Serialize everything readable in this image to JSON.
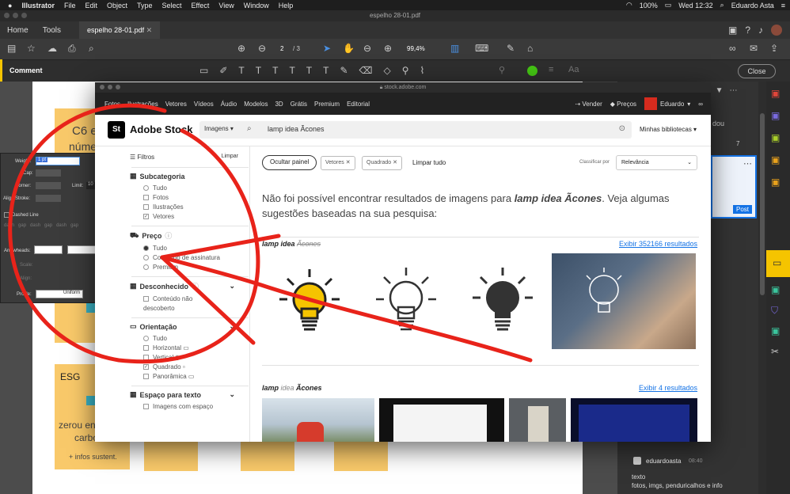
{
  "menubar": {
    "app": "Illustrator",
    "items": [
      "File",
      "Edit",
      "Object",
      "Type",
      "Select",
      "Effect",
      "View",
      "Window",
      "Help"
    ],
    "battery": "100%",
    "time": "Wed 12:32",
    "user": "Eduardo Asta"
  },
  "window_title": "espelho 28-01.pdf",
  "tabs": {
    "home": "Home",
    "tools": "Tools",
    "doc": "espelho 28-01.pdf"
  },
  "toolbar": {
    "page": "2",
    "pages": "/ 3",
    "zoom": "99,4%"
  },
  "commentbar": {
    "label": "Comment",
    "close": "Close"
  },
  "stroke_panel": {
    "weight_label": "Weight:",
    "weight_value": "1 pt",
    "cap": "Cap:",
    "corner": "Corner:",
    "limit": "Limit:",
    "limit_value": "10",
    "align": "Align Stroke:",
    "dashed": "Dashed Line",
    "dash": "dash",
    "gap": "gap",
    "arrowheads": "Arrowheads:",
    "scale": "Scale:",
    "align2": "Align:",
    "profile": "Profile:",
    "profile_value": "Uniform"
  },
  "stickies": {
    "c6": "C6 e",
    "numer": "núme",
    "esg": "ESG",
    "zerou": "zerou en",
    "carbo": "carbo",
    "infos": "+ infos sustent."
  },
  "stock": {
    "url": "stock.adobe.com",
    "nav": [
      "Fotos",
      "Ilustrações",
      "Vetores",
      "Vídeos",
      "Áudio",
      "Modelos",
      "3D",
      "Grátis",
      "Premium",
      "Editorial"
    ],
    "sell": "Vender",
    "prices": "Preços",
    "user": "Eduardo",
    "logo_badge": "St",
    "logo": "Adobe Stock",
    "search_type": "Imagens",
    "search_value": "lamp idea Ãcones",
    "libraries": "Minhas bibliotecas",
    "filters": "Filtros",
    "clear": "Limpar",
    "subcategory": "Subcategoria",
    "sub_opts": [
      "Tudo",
      "Fotos",
      "Ilustrações",
      "Vetores"
    ],
    "price": "Preço",
    "price_opts": [
      "Tudo",
      "Conteúdo de assinatura",
      "Premium"
    ],
    "unknown": "Desconhecido",
    "unknown_opts": [
      "Conteúdo não",
      "descoberto"
    ],
    "orientation": "Orientação",
    "orient_opts": [
      "Tudo",
      "Horizontal",
      "Vertical",
      "Quadrado",
      "Panorâmica"
    ],
    "textspace": "Espaço para texto",
    "textspace_opt": "Imagens com espaço",
    "hide_panel": "Ocultar painel",
    "chip1": "Vetores",
    "chip2": "Quadrado",
    "clear_all": "Limpar tudo",
    "sort_label": "Classificar por",
    "sort_value": "Relevância",
    "noresult_pre": "Não foi possível encontrar resultados de imagens para ",
    "noresult_q": "lamp idea Ãcones",
    "noresult_post": ". Veja algumas sugestões baseadas na sua pesquisa:",
    "s1_a": "lamp idea ",
    "s1_b": "Ãcones",
    "s1_link": "Exibir 352166 resultados",
    "s2_a": "lamp ",
    "s2_b": "idea",
    "s2_c": " Ãcones",
    "s2_link": "Exibir 4 resultados"
  },
  "right_panel": {
    "text1": "dou",
    "num": "7",
    "post": "Post",
    "author": "eduardoasta",
    "time": "08:40",
    "msg1": "texto",
    "msg2": "fotos, imgs, penduricalhos e info"
  },
  "colors": {
    "accent": "#f5c400",
    "link": "#1473e6",
    "annotation": "#e8231a",
    "sticky": "#f9c96a"
  }
}
